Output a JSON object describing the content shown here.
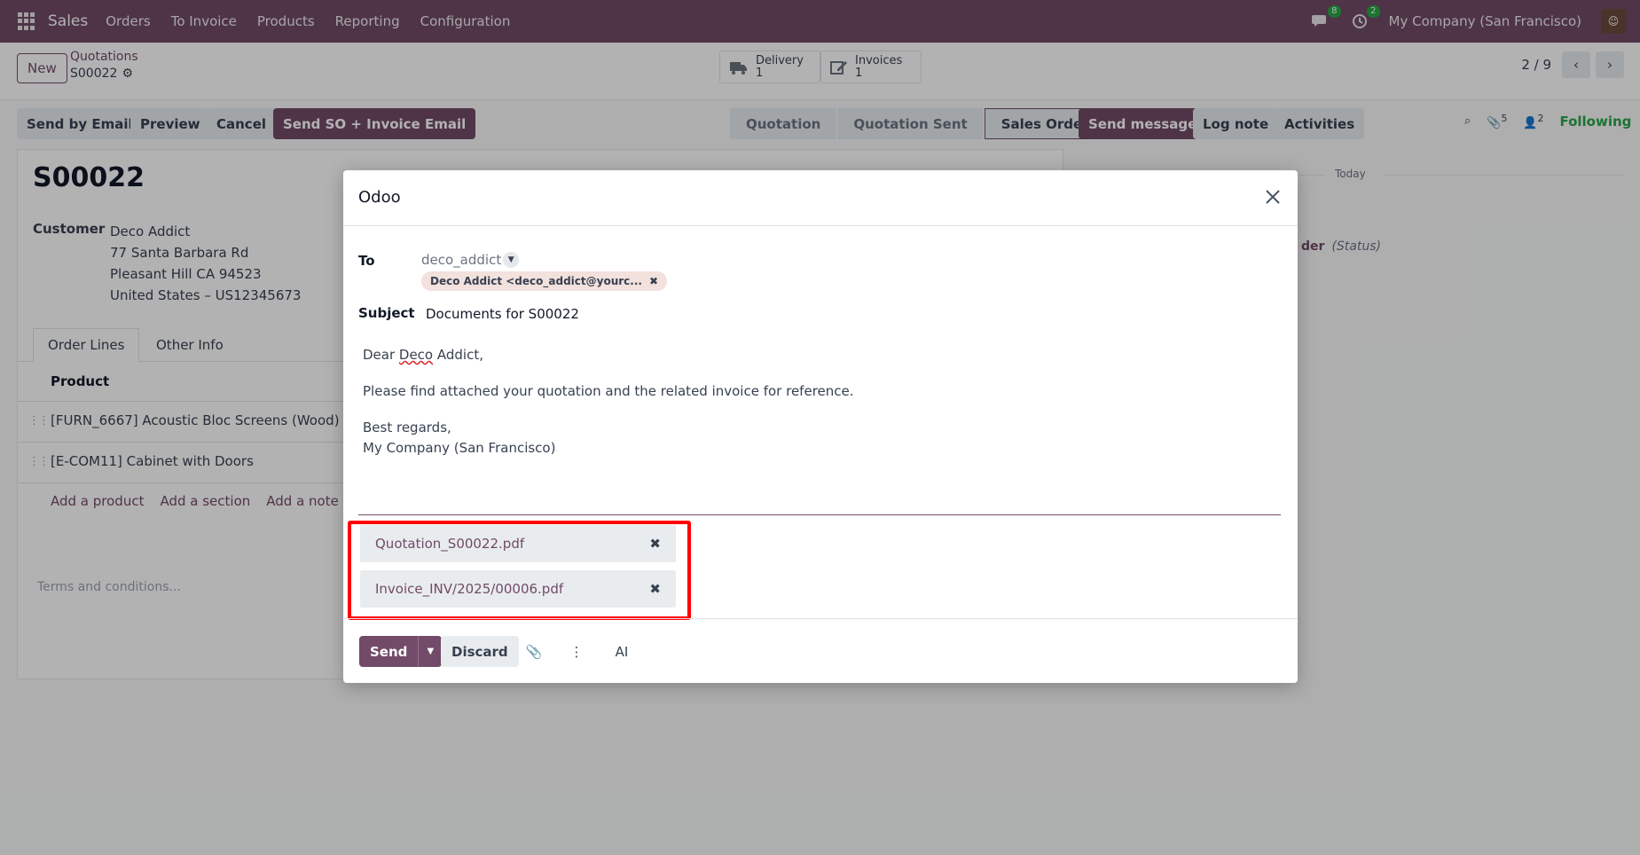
{
  "navbar": {
    "brand": "Sales",
    "menu": [
      "Orders",
      "To Invoice",
      "Products",
      "Reporting",
      "Configuration"
    ],
    "messages_count": "8",
    "activities_count": "2",
    "company": "My Company (San Francisco)"
  },
  "control": {
    "new_label": "New",
    "breadcrumb_parent": "Quotations",
    "breadcrumb_current": "S00022",
    "delivery_label": "Delivery",
    "delivery_count": "1",
    "invoices_label": "Invoices",
    "invoices_count": "1",
    "pager": "2 / 9"
  },
  "actions": {
    "send_email": "Send by Email",
    "preview": "Preview",
    "cancel": "Cancel",
    "send_so_invoice": "Send SO + Invoice Email",
    "stages": [
      "Quotation",
      "Quotation Sent",
      "Sales Order"
    ],
    "active_stage": "Sales Order",
    "send_message": "Send message",
    "log_note": "Log note",
    "activities": "Activities",
    "attachments_count": "5",
    "followers_count": "2",
    "following": "Following"
  },
  "form": {
    "title": "S00022",
    "customer_label": "Customer",
    "customer_lines": [
      "Deco Addict",
      "77 Santa Barbara Rd",
      "Pleasant Hill CA 94523",
      "United States – US12345673"
    ],
    "tabs": [
      "Order Lines",
      "Other Info"
    ],
    "product_header": "Product",
    "lines": [
      "[FURN_6667] Acoustic Bloc Screens (Wood)",
      "[E-COM11] Cabinet with Doors"
    ],
    "add_links": [
      "Add a product",
      "Add a section",
      "Add a note"
    ],
    "terms_placeholder": "Terms and conditions..."
  },
  "chatter": {
    "today": "Today",
    "status_fragment": "der",
    "status_label": "(Status)"
  },
  "dialog": {
    "title": "Odoo",
    "to_label": "To",
    "to_value": "deco_addict",
    "recipient_tag": "Deco Addict <deco_addict@yourc...",
    "subject_label": "Subject",
    "subject_value": "Documents for S00022",
    "body_greeting_pre": "Dear ",
    "body_greeting_word": "Deco",
    "body_greeting_post": " Addict,",
    "body_line": "Please find attached your quotation and the related invoice for reference.",
    "body_closing": "Best regards,",
    "body_signature": "My Company (San Francisco)",
    "attachments": [
      "Quotation_S00022.pdf",
      "Invoice_INV/2025/00006.pdf"
    ],
    "send_label": "Send",
    "discard_label": "Discard",
    "ai_label": "AI"
  },
  "colors": {
    "brand": "#714b67",
    "highlight": "#ff0000",
    "success": "#28a745"
  }
}
